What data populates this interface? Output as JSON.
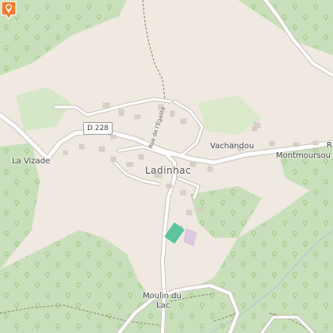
{
  "map": {
    "labels": {
      "town": "Ladinhac",
      "vachandou": "Vachandou",
      "montmoursou": "Montmoursou",
      "la_vizade": "La Vizade",
      "moulin_line1": "Moulin du",
      "moulin_line2": "Lac",
      "street": "Rue de l'Égalité",
      "road_number": "D 228",
      "edge_letter": "R"
    },
    "marker_icon": "map-pin-icon",
    "colors": {
      "background": "#efe9e1",
      "forest": "#c9dfbb",
      "forest_dark": "#b5d2a2",
      "tree": "#8fbf6f",
      "road": "#ffffff",
      "road_casing": "#c8c2ba",
      "building": "#d9d0c9",
      "marker": "#f07c2e",
      "pitch": "#5bc5a0",
      "cemetery": "#ddc9df"
    }
  }
}
